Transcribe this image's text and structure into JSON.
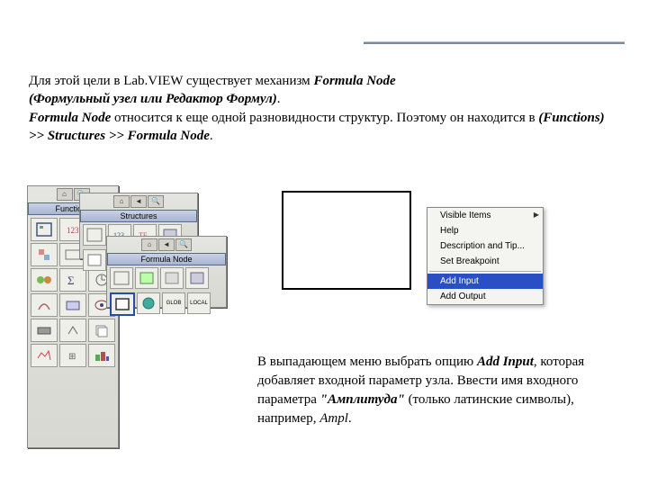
{
  "para1": {
    "t1": "Для этой цели в Lab.VIEW существует механизм ",
    "fn": "Formula Node",
    "t2": "(Формульный узел или Редактор Формул)",
    "t3": "Formula Node",
    "t4": " относится к еще одной разновидности структур. Поэтому он находится в ",
    "path": "(Functions) >> Structures >> Formula Node",
    "dot": "."
  },
  "palettes": {
    "main_title": "Functions",
    "sub1_title": "Structures",
    "sub2_title": "Formula Node",
    "sub2_label1": "GLOB",
    "sub2_label2": "LOCAL"
  },
  "context_menu": {
    "items": [
      "Visible Items",
      "Help",
      "Description and Tip...",
      "Set Breakpoint"
    ],
    "add_input": "Add Input",
    "add_output": "Add Output"
  },
  "para2": {
    "t1": "В выпадающем меню выбрать опцию ",
    "ai": "Add Input",
    "t2": ", которая добавляет входной параметр узла. Ввести имя входного параметра ",
    "amp": "\"Амплитуда\"",
    "t3": " (только латинские символы), например, ",
    "ampl": "Ampl",
    "dot": "."
  }
}
